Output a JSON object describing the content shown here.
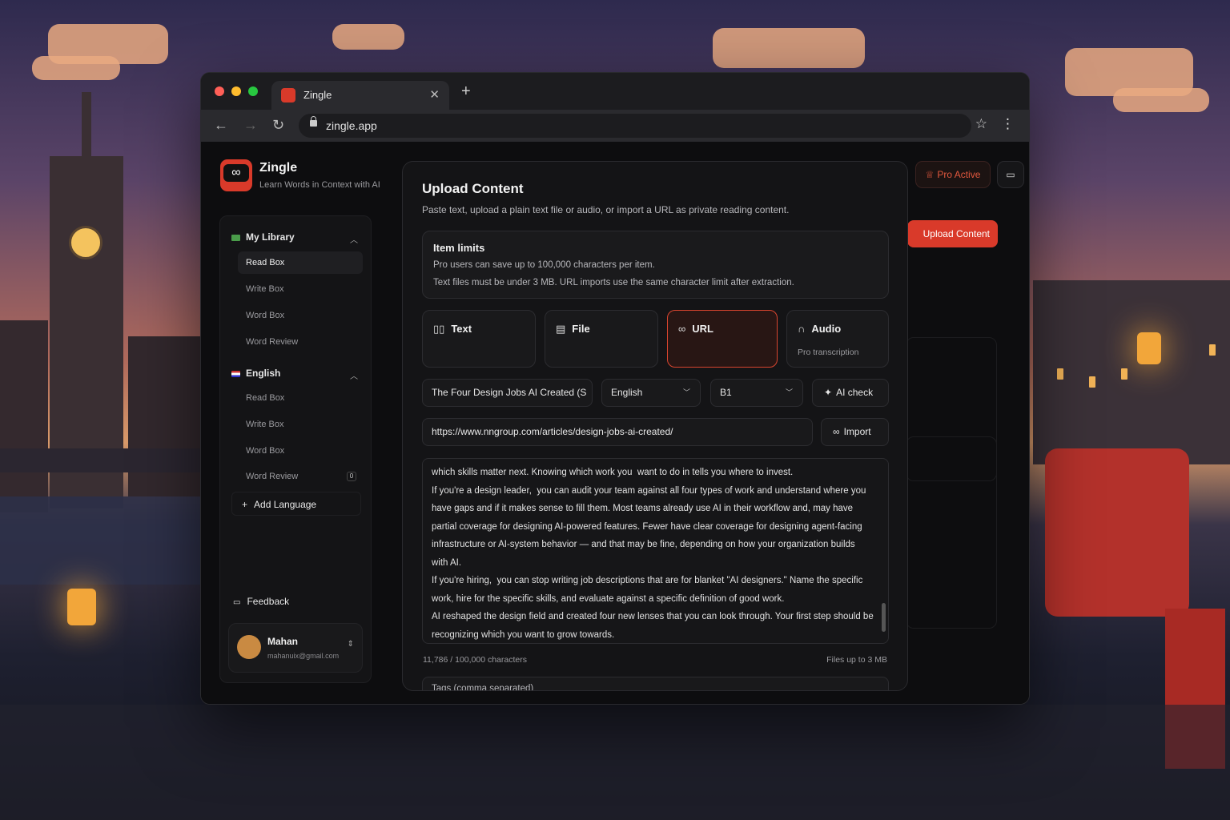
{
  "browser": {
    "tab_title": "Zingle",
    "new_tab": "+",
    "close": "✕",
    "url": "zingle.app",
    "back": "←",
    "forward": "→",
    "reload": "↻",
    "star": "☆",
    "menu": "⋮"
  },
  "app": {
    "name": "Zingle",
    "tagline": "Learn Words in Context with AI",
    "pro_label": "Pro Active",
    "upload_label": "Upload Content"
  },
  "sidebar": {
    "library_title": "My Library",
    "library_items": [
      "Read Box",
      "Write Box",
      "Word Box",
      "Word Review"
    ],
    "language_title": "English",
    "language_items": [
      "Read Box",
      "Write Box",
      "Word Box",
      "Word Review"
    ],
    "review_badge": "0",
    "add_language": "Add Language",
    "feedback": "Feedback",
    "user_name": "Mahan",
    "user_email": "mahanuix@gmail.com"
  },
  "modal": {
    "title": "Upload Content",
    "subtitle": "Paste text, upload a plain text file or audio, or import a URL as private reading content.",
    "limits_title": "Item limits",
    "limits_line1": "Pro users can save up to 100,000 characters per item.",
    "limits_line2": "Text files must be under 3 MB. URL imports use the same character limit after extraction.",
    "source_types": [
      {
        "label": "Text",
        "icon": "book-icon"
      },
      {
        "label": "File",
        "icon": "file-icon"
      },
      {
        "label": "URL",
        "icon": "link-icon"
      },
      {
        "label": "Audio",
        "icon": "headphones-icon",
        "sub": "Pro transcription"
      }
    ],
    "selected_type": "URL",
    "title_value": "The Four Design Jobs AI Created (S",
    "language_value": "English",
    "level_value": "B1",
    "ai_check": "AI check",
    "url_value": "https://www.nngroup.com/articles/design-jobs-ai-created/",
    "import_label": "Import",
    "content": "which skills matter next. Knowing which work you  want to do in tells you where to invest.\nIf you're a design leader,  you can audit your team against all four types of work and understand where you have gaps and if it makes sense to fill them. Most teams already use AI in their workflow and, may have partial coverage for designing AI-powered features. Fewer have clear coverage for designing agent-facing infrastructure or AI-system behavior — and that may be fine, depending on how your organization builds with AI.\nIf you're hiring,  you can stop writing job descriptions that are for blanket \"AI designers.\" Name the specific work, hire for the specific skills, and evaluate against a specific definition of good work.\nAI reshaped the design field and created four new lenses that you can look through. Your first step should be recognizing which you want to grow towards.",
    "char_count": "11,786 / 100,000 characters",
    "file_limit": "Files up to 3 MB",
    "tags_placeholder": "Tags (comma separated)"
  },
  "colors": {
    "accent": "#d93a2a",
    "bg": "#0d0d0f"
  }
}
